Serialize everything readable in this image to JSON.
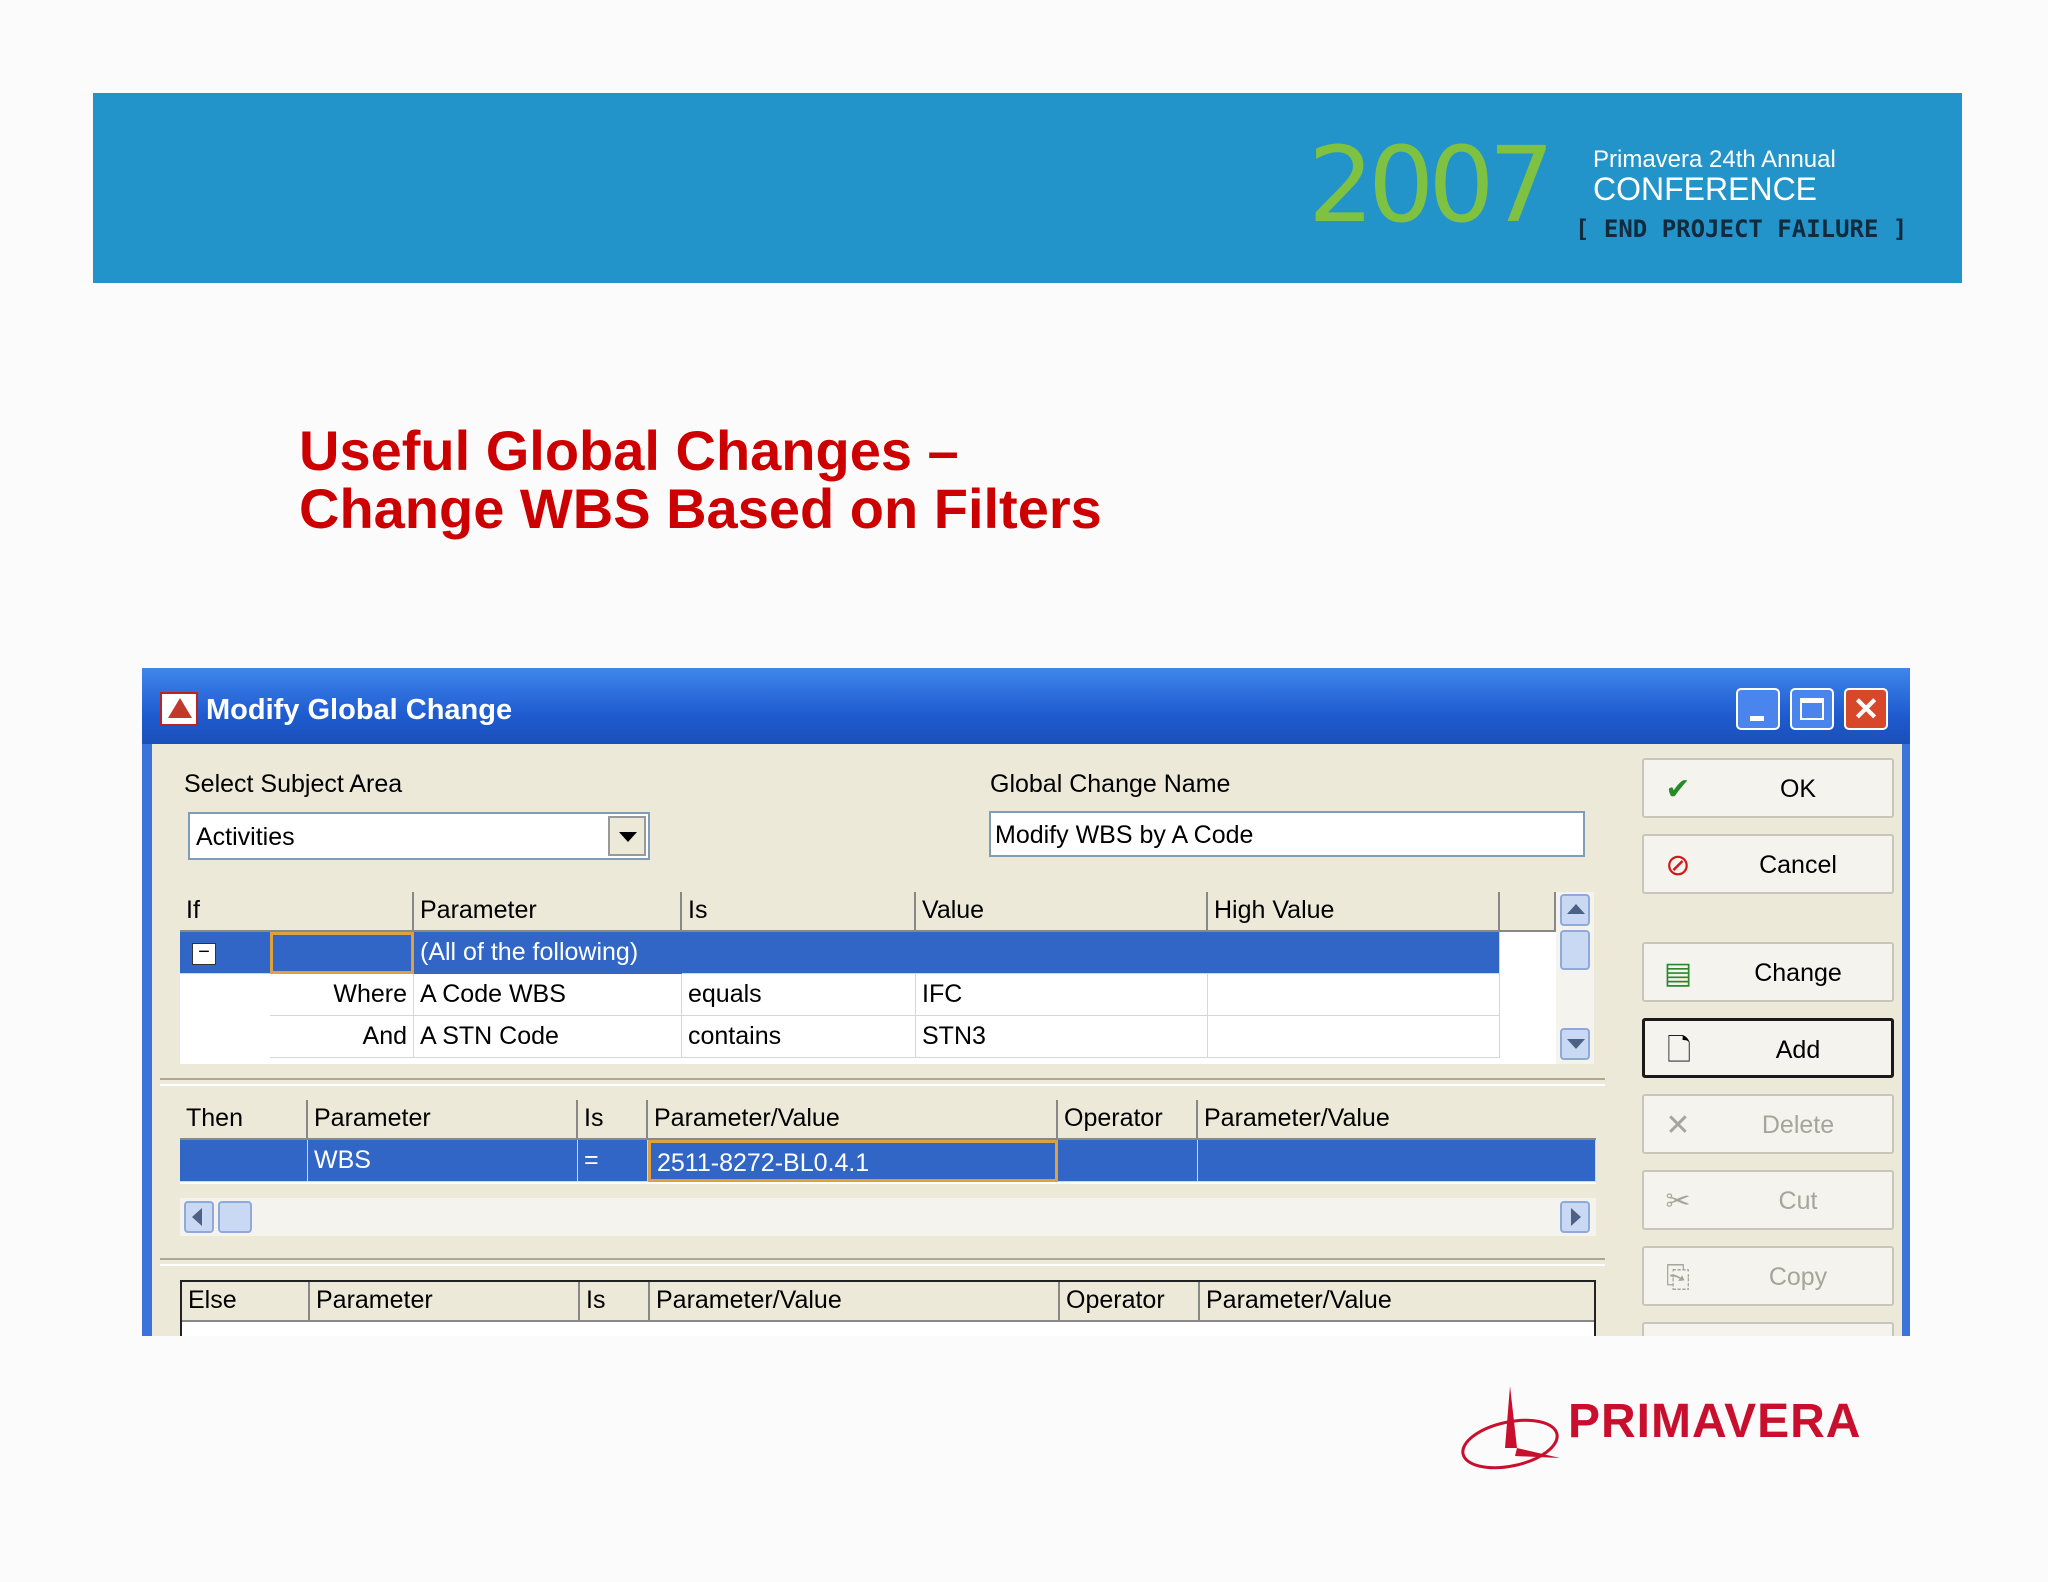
{
  "banner": {
    "year": "2007",
    "line1": "Primavera 24th Annual",
    "line2": "CONFERENCE",
    "line3": "[ END PROJECT FAILURE ]"
  },
  "slide_title": {
    "line1": "Useful Global Changes –",
    "line2": "Change WBS Based on Filters"
  },
  "dialog": {
    "title": "Modify Global Change",
    "subject_label": "Select Subject Area",
    "subject_value": "Activities",
    "name_label": "Global Change Name",
    "name_value": "Modify WBS by A Code",
    "if_grid": {
      "headers": [
        "If",
        "Parameter",
        "Is",
        "Value",
        "High Value"
      ],
      "rows": [
        {
          "cond": "",
          "parameter": "(All of the following)",
          "is": "",
          "value": "",
          "high": "",
          "expander": "−"
        },
        {
          "cond": "Where",
          "parameter": "A Code WBS",
          "is": "equals",
          "value": "IFC",
          "high": ""
        },
        {
          "cond": "And",
          "parameter": "A STN Code",
          "is": "contains",
          "value": "STN3",
          "high": ""
        }
      ]
    },
    "then_grid": {
      "headers": [
        "Then",
        "Parameter",
        "Is",
        "Parameter/Value",
        "Operator",
        "Parameter/Value"
      ],
      "rows": [
        {
          "then": "",
          "parameter": "WBS",
          "is": "=",
          "value": "2511-8272-BL0.4.1",
          "operator": "",
          "value2": ""
        }
      ]
    },
    "else_grid": {
      "headers": [
        "Else",
        "Parameter",
        "Is",
        "Parameter/Value",
        "Operator",
        "Parameter/Value"
      ]
    },
    "buttons": {
      "ok": "OK",
      "cancel": "Cancel",
      "change": "Change",
      "add": "Add",
      "delete": "Delete",
      "cut": "Cut",
      "copy": "Copy"
    },
    "colors": {
      "selection": "#3166c6",
      "titlebar": "#1f5cd1",
      "face": "#ece9d8"
    }
  },
  "logo": {
    "word": "PRIMAVERA"
  }
}
